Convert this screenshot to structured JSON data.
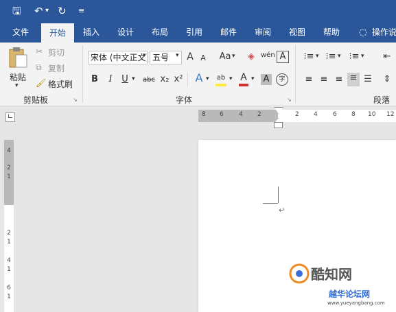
{
  "qat": {
    "save_icon": "save-icon",
    "undo_icon": "undo-icon",
    "redo_icon": "redo-icon",
    "customize_icon": "customize-icon"
  },
  "tabs": [
    "文件",
    "开始",
    "插入",
    "设计",
    "布局",
    "引用",
    "邮件",
    "审阅",
    "视图",
    "帮助"
  ],
  "tell_me": "操作说明",
  "clipboard": {
    "paste": "粘贴",
    "cut": "剪切",
    "copy": "复制",
    "format_painter": "格式刷",
    "group": "剪贴板"
  },
  "font": {
    "family": "宋体 (中文正文)",
    "size": "五号",
    "case": "Aa",
    "grow": "A",
    "shrink": "A",
    "clear": "A",
    "phonetic": "wén",
    "border": "A",
    "bold": "B",
    "italic": "I",
    "underline": "U",
    "strike": "abc",
    "subscript": "x₂",
    "superscript": "x²",
    "effects": "A",
    "highlight": "ab",
    "color": "A",
    "shade": "A",
    "enclose": "字",
    "group": "字体"
  },
  "paragraph": {
    "group": "段落"
  },
  "ruler_h": [
    "8",
    "6",
    "4",
    "2",
    "2",
    "4",
    "6",
    "8",
    "10",
    "12"
  ],
  "ruler_v": [
    "4",
    "2",
    "1",
    "2",
    "1",
    "4",
    "1",
    "6",
    "1"
  ],
  "watermark": {
    "primary": "酷知网",
    "secondary": "越华论坛网",
    "url": "www.yueyangbang.com"
  },
  "colors": {
    "ribbon_blue": "#2b579a",
    "highlight_yellow": "#ffeb3b",
    "font_red": "#d32f2f"
  }
}
